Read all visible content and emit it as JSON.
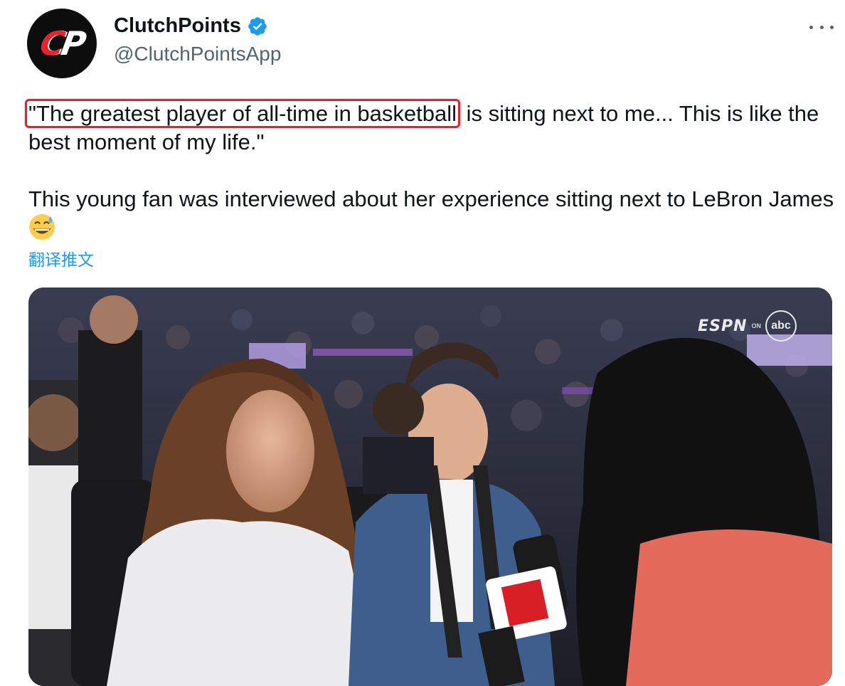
{
  "account": {
    "display_name": "ClutchPoints",
    "handle": "@ClutchPointsApp",
    "avatar_text_c": "C",
    "avatar_text_p": "P",
    "verified": true
  },
  "tweet": {
    "highlighted_text": "\"The greatest player of all-time in basketball",
    "line1_rest": " is sitting next to me... This is like the best moment of my life.\"",
    "line2": "This young fan was interviewed about her experience sitting next to LeBron James",
    "emoji": "grinning-face-with-sweat",
    "translate_label": "翻译推文"
  },
  "media": {
    "broadcast_logo_text": "ESPN",
    "broadcast_on": "ON",
    "broadcast_network": "abc",
    "description_icon": "video-still"
  },
  "colors": {
    "link": "#1d9bf0",
    "highlight_border": "#e0242d",
    "verified": "#1d9bf0",
    "secondary_text": "#536471"
  }
}
